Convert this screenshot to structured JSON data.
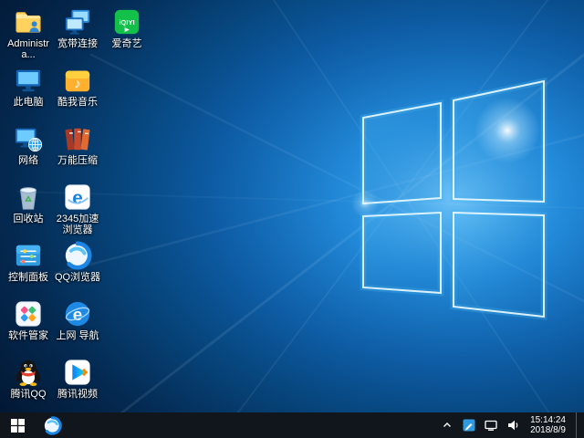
{
  "desktop": {
    "icons": [
      {
        "label": "Administra...",
        "icon": "user-folder-icon"
      },
      {
        "label": "此电脑",
        "icon": "computer-icon"
      },
      {
        "label": "网络",
        "icon": "network-icon"
      },
      {
        "label": "回收站",
        "icon": "recycle-bin-icon"
      },
      {
        "label": "控制面板",
        "icon": "control-panel-icon"
      },
      {
        "label": "软件管家",
        "icon": "software-manager-icon"
      },
      {
        "label": "腾讯QQ",
        "icon": "qq-penguin-icon"
      },
      {
        "label": "宽带连接",
        "icon": "broadband-icon"
      },
      {
        "label": "酷我音乐",
        "icon": "kuwo-music-icon"
      },
      {
        "label": "万能压缩",
        "icon": "compressor-icon"
      },
      {
        "label": "2345加速浏览器",
        "icon": "2345-browser-icon"
      },
      {
        "label": "QQ浏览器",
        "icon": "qq-browser-icon"
      },
      {
        "label": "上网 导航",
        "icon": "navigation-icon"
      },
      {
        "label": "腾讯视频",
        "icon": "tencent-video-icon"
      },
      {
        "label": "爱奇艺",
        "icon": "iqiyi-icon"
      }
    ]
  },
  "icon_text": {
    "iqiyi": "iQIYI",
    "nav_e": "e",
    "browser_e": "e",
    "music_note": "♪"
  },
  "taskbar": {
    "time": "15:14:24",
    "date": "2018/8/9"
  },
  "colors": {
    "taskbar_bg": "#11161d",
    "wallpaper_blue": "#1b7fd0",
    "label_text": "#ffffff"
  }
}
